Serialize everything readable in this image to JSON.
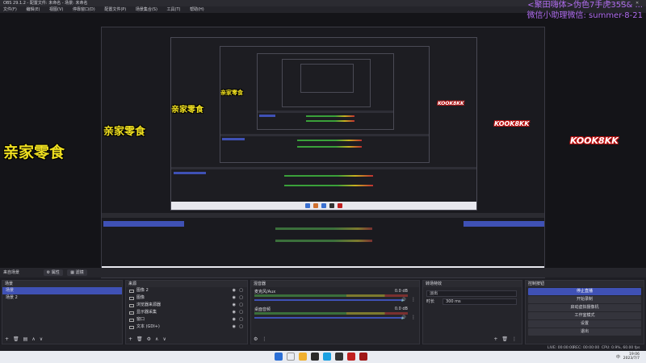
{
  "window": {
    "title": "OBS 29.1.2 - 配置文件: 未命名 - 场景: 未命名",
    "controls": [
      "—",
      "□",
      "✕"
    ]
  },
  "menu": [
    "文件(F)",
    "编辑(E)",
    "视图(V)",
    "停靠窗口(D)",
    "配置文件(P)",
    "场景集合(S)",
    "工具(T)",
    "帮助(H)"
  ],
  "overlays": {
    "line1": "<聚田嗨体>伪色7手虎35S& ...",
    "line2": "微信小助理微信: summer-8-21"
  },
  "brand": {
    "name": "亲家零食",
    "logo": "KOOK8KK"
  },
  "controls_row": {
    "label": "来自场景",
    "btn_properties": "属性",
    "btn_filters": "滤镜"
  },
  "scenes": {
    "title": "场景",
    "items": [
      {
        "label": "场景",
        "selected": true
      },
      {
        "label": "场景 2",
        "selected": false
      }
    ]
  },
  "sources": {
    "title": "来源",
    "items": [
      {
        "label": "图像 2",
        "icon": "image-icon"
      },
      {
        "label": "图像",
        "icon": "image-icon"
      },
      {
        "label": "浏览器来源器",
        "icon": "browser-icon"
      },
      {
        "label": "显示器采集",
        "icon": "monitor-icon"
      },
      {
        "label": "窗口",
        "icon": "window-icon"
      },
      {
        "label": "文本 (GDI+)",
        "icon": "text-icon"
      }
    ]
  },
  "mixer": {
    "title": "混音器",
    "channels": [
      {
        "name": "麦克风/Aux",
        "db": "0.0 dB"
      },
      {
        "name": "桌面音频",
        "db": "0.0 dB"
      }
    ]
  },
  "transitions": {
    "title": "转场特效",
    "type": "淡出",
    "duration_label": "时长",
    "duration": "300 ms"
  },
  "controls": {
    "title": "控制按钮",
    "buttons": [
      "停止直播",
      "开始录制",
      "启动虚拟摄像机",
      "工作室模式",
      "设置",
      "退出"
    ]
  },
  "status": {
    "live": "LIVE: 00:00:00",
    "rec": "REC: 00:00:00",
    "cpu": "CPU: 0.9%, 60.00 fps"
  },
  "taskbar": {
    "time": "19:06",
    "date": "2023/7/7",
    "lang": "中"
  },
  "colors": {
    "accent": "#3f51b5",
    "brand_text": "#f0e020",
    "overlay_text": "#b06cf0"
  }
}
